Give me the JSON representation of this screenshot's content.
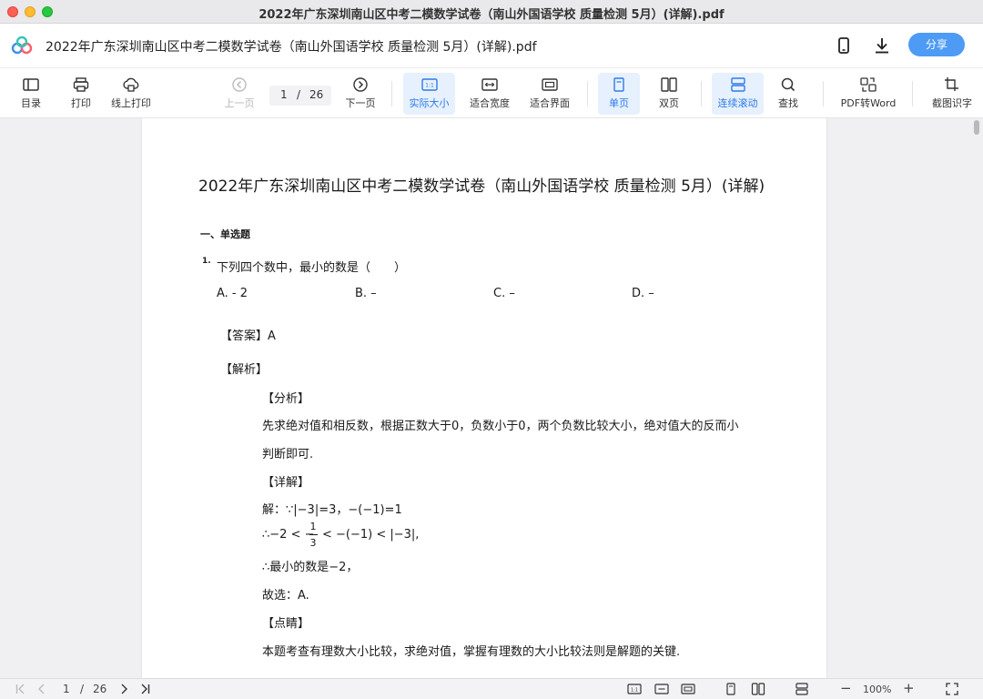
{
  "window": {
    "title": "2022年广东深圳南山区中考二模数学试卷（南山外国语学校 质量检测 5月）(详解).pdf"
  },
  "header": {
    "doc_title": "2022年广东深圳南山区中考二模数学试卷（南山外国语学校 质量检测 5月）(详解).pdf",
    "share_label": "分享",
    "icons": [
      "app-logo",
      "phone-icon",
      "download-icon"
    ]
  },
  "toolbar": {
    "toc": "目录",
    "print": "打印",
    "online_print": "线上打印",
    "prev": "上一页",
    "page_current": "1",
    "page_sep": "/",
    "page_total": "26",
    "next": "下一页",
    "actual_size": "实际大小",
    "fit_width": "适合宽度",
    "fit_page": "适合界面",
    "single_page": "单页",
    "double_page": "双页",
    "continuous": "连续滚动",
    "find": "查找",
    "pdf_to_word": "PDF转Word",
    "ocr": "截图识字",
    "active_colors": {
      "accent": "#2d7ae8",
      "active_bg": "#e7f1fd",
      "share_bg": "#4d9bf5"
    }
  },
  "document": {
    "title": "2022年广东深圳南山区中考二模数学试卷（南山外国语学校 质量检测 5月）(详解)",
    "section": "一、单选题",
    "q_number": "1.",
    "question": "下列四个数中，最小的数是（　　）",
    "options": [
      {
        "label": "A.  - 2"
      },
      {
        "label": "B. –"
      },
      {
        "label": "C. –"
      },
      {
        "label": "D. –"
      }
    ],
    "answer": "【答案】A",
    "analysis_head": "【解析】",
    "fenxi_head": "【分析】",
    "fenxi_line1": "先求绝对值和相反数，根据正数大于0，负数小于0，两个负数比较大小，绝对值大的反而小",
    "fenxi_line2": "判断即可.",
    "xiangjie_head": "【详解】",
    "solve_line1": "解：∵|−3|=3，−(−1)=1",
    "solve_line2_pre": "∴−2 < −",
    "frac_num": "1",
    "frac_den": "3",
    "solve_line2_post": "< −(−1) < |−3|,",
    "solve_line3": "∴最小的数是−2，",
    "solve_line4": "故选：A.",
    "dianjing_head": "【点睛】",
    "dianjing_text": "本题考查有理数大小比较，求绝对值，掌握有理数的大小比较法则是解题的关键."
  },
  "bottombar": {
    "page_current": "1",
    "page_sep": "/",
    "page_total": "26",
    "zoom": "100%",
    "zoom_minus": "−",
    "zoom_plus": "+"
  }
}
